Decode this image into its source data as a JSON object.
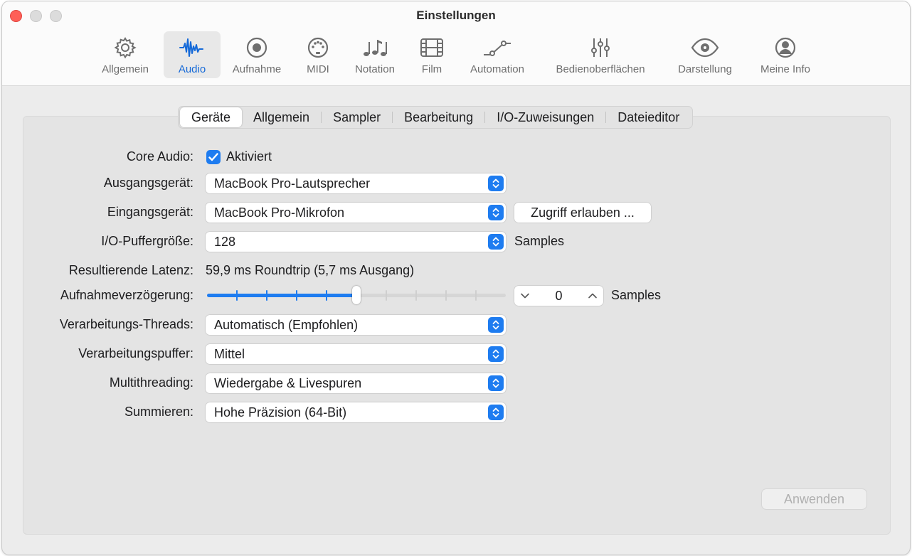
{
  "window": {
    "title": "Einstellungen"
  },
  "toolbar": {
    "items": [
      {
        "label": "Allgemein",
        "icon": "gear-icon"
      },
      {
        "label": "Audio",
        "icon": "waveform-icon"
      },
      {
        "label": "Aufnahme",
        "icon": "record-icon"
      },
      {
        "label": "MIDI",
        "icon": "midi-icon"
      },
      {
        "label": "Notation",
        "icon": "notes-icon"
      },
      {
        "label": "Film",
        "icon": "film-icon"
      },
      {
        "label": "Automation",
        "icon": "automation-icon"
      },
      {
        "label": "Bedienoberflächen",
        "icon": "sliders-icon"
      },
      {
        "label": "Darstellung",
        "icon": "eye-icon"
      },
      {
        "label": "Meine Info",
        "icon": "person-icon"
      }
    ],
    "active": "Audio"
  },
  "tabs": {
    "items": [
      "Geräte",
      "Allgemein",
      "Sampler",
      "Bearbeitung",
      "I/O-Zuweisungen",
      "Dateieditor"
    ],
    "selected": "Geräte"
  },
  "form": {
    "core_audio": {
      "label": "Core Audio:",
      "checkbox_label": "Aktiviert",
      "checked": true
    },
    "output_device": {
      "label": "Ausgangsgerät:",
      "value": "MacBook Pro-Lautsprecher"
    },
    "input_device": {
      "label": "Eingangsgerät:",
      "value": "MacBook Pro-Mikrofon",
      "access_button": "Zugriff erlauben ..."
    },
    "buffer_size": {
      "label": "I/O-Puffergröße:",
      "value": "128",
      "unit": "Samples"
    },
    "latency": {
      "label": "Resultierende Latenz:",
      "value": "59,9 ms Roundtrip (5,7 ms Ausgang)"
    },
    "recording_delay": {
      "label": "Aufnahmeverzögerung:",
      "value": "0",
      "unit": "Samples",
      "slider_fraction": 0.5
    },
    "threads": {
      "label": "Verarbeitungs-Threads:",
      "value": "Automatisch (Empfohlen)"
    },
    "process_buffer": {
      "label": "Verarbeitungspuffer:",
      "value": "Mittel"
    },
    "multithreading": {
      "label": "Multithreading:",
      "value": "Wiedergabe & Livespuren"
    },
    "summing": {
      "label": "Summieren:",
      "value": "Hohe Präzision (64-Bit)"
    }
  },
  "apply_button": "Anwenden",
  "colors": {
    "accent": "#1e7cf0",
    "close": "#fe5f57",
    "active_label": "#1469d8"
  }
}
